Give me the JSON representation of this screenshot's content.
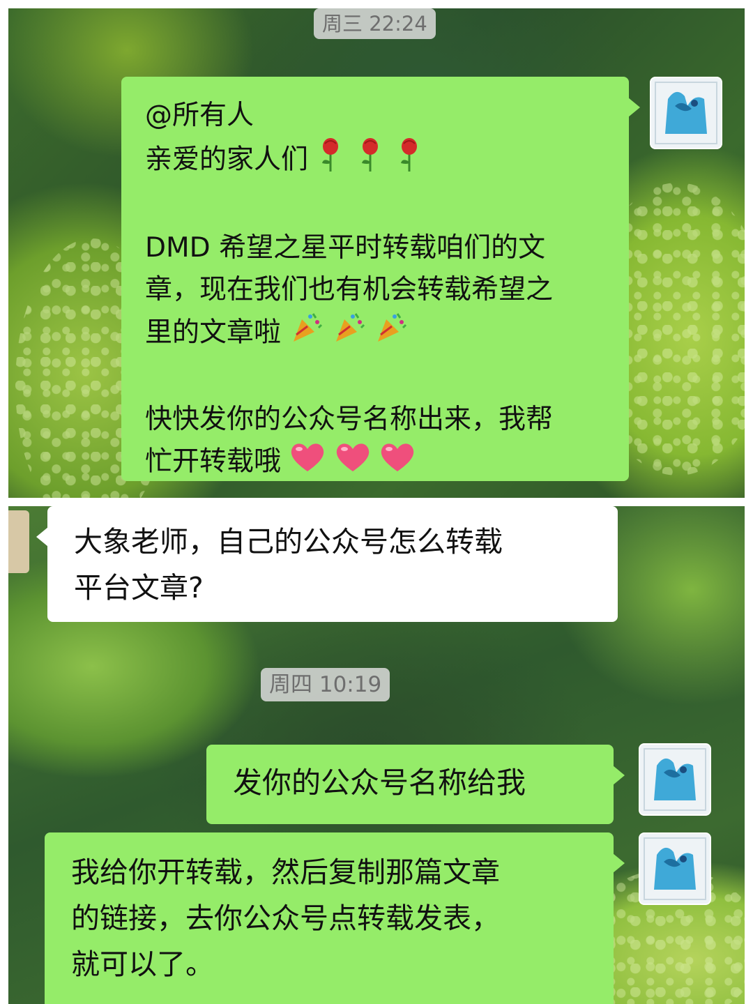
{
  "top_panel": {
    "timestamp": "周三 22:24",
    "message": {
      "lines": [
        "@所有人",
        "亲爱的家人们",
        "",
        "DMD 希望之星平时转载咱们的文",
        "章，现在我们也有机会转载希望之",
        "里的文章啦",
        "",
        "快快发你的公众号名称出来，我帮",
        "忙开转载哦"
      ],
      "line2_emoji": "rose-icon x3",
      "line6_emoji": "party-popper-icon x3",
      "line9_emoji": "heart-icon x3"
    }
  },
  "bottom_panel": {
    "peer_message": {
      "lines": [
        "大象老师，自己的公众号怎么转载",
        "平台文章?"
      ]
    },
    "timestamp": "周四 10:19",
    "reply_1": {
      "text": "发你的公众号名称给我"
    },
    "reply_2": {
      "lines": [
        "我给你开转载，然后复制那篇文章",
        "的链接，去你公众号点转载发表，",
        "就可以了。"
      ]
    }
  },
  "colors": {
    "bubble_green": "#95ec69",
    "bubble_white": "#ffffff",
    "timestamp_bg": "#dcdcdc",
    "timestamp_text": "#6e6e6e"
  }
}
